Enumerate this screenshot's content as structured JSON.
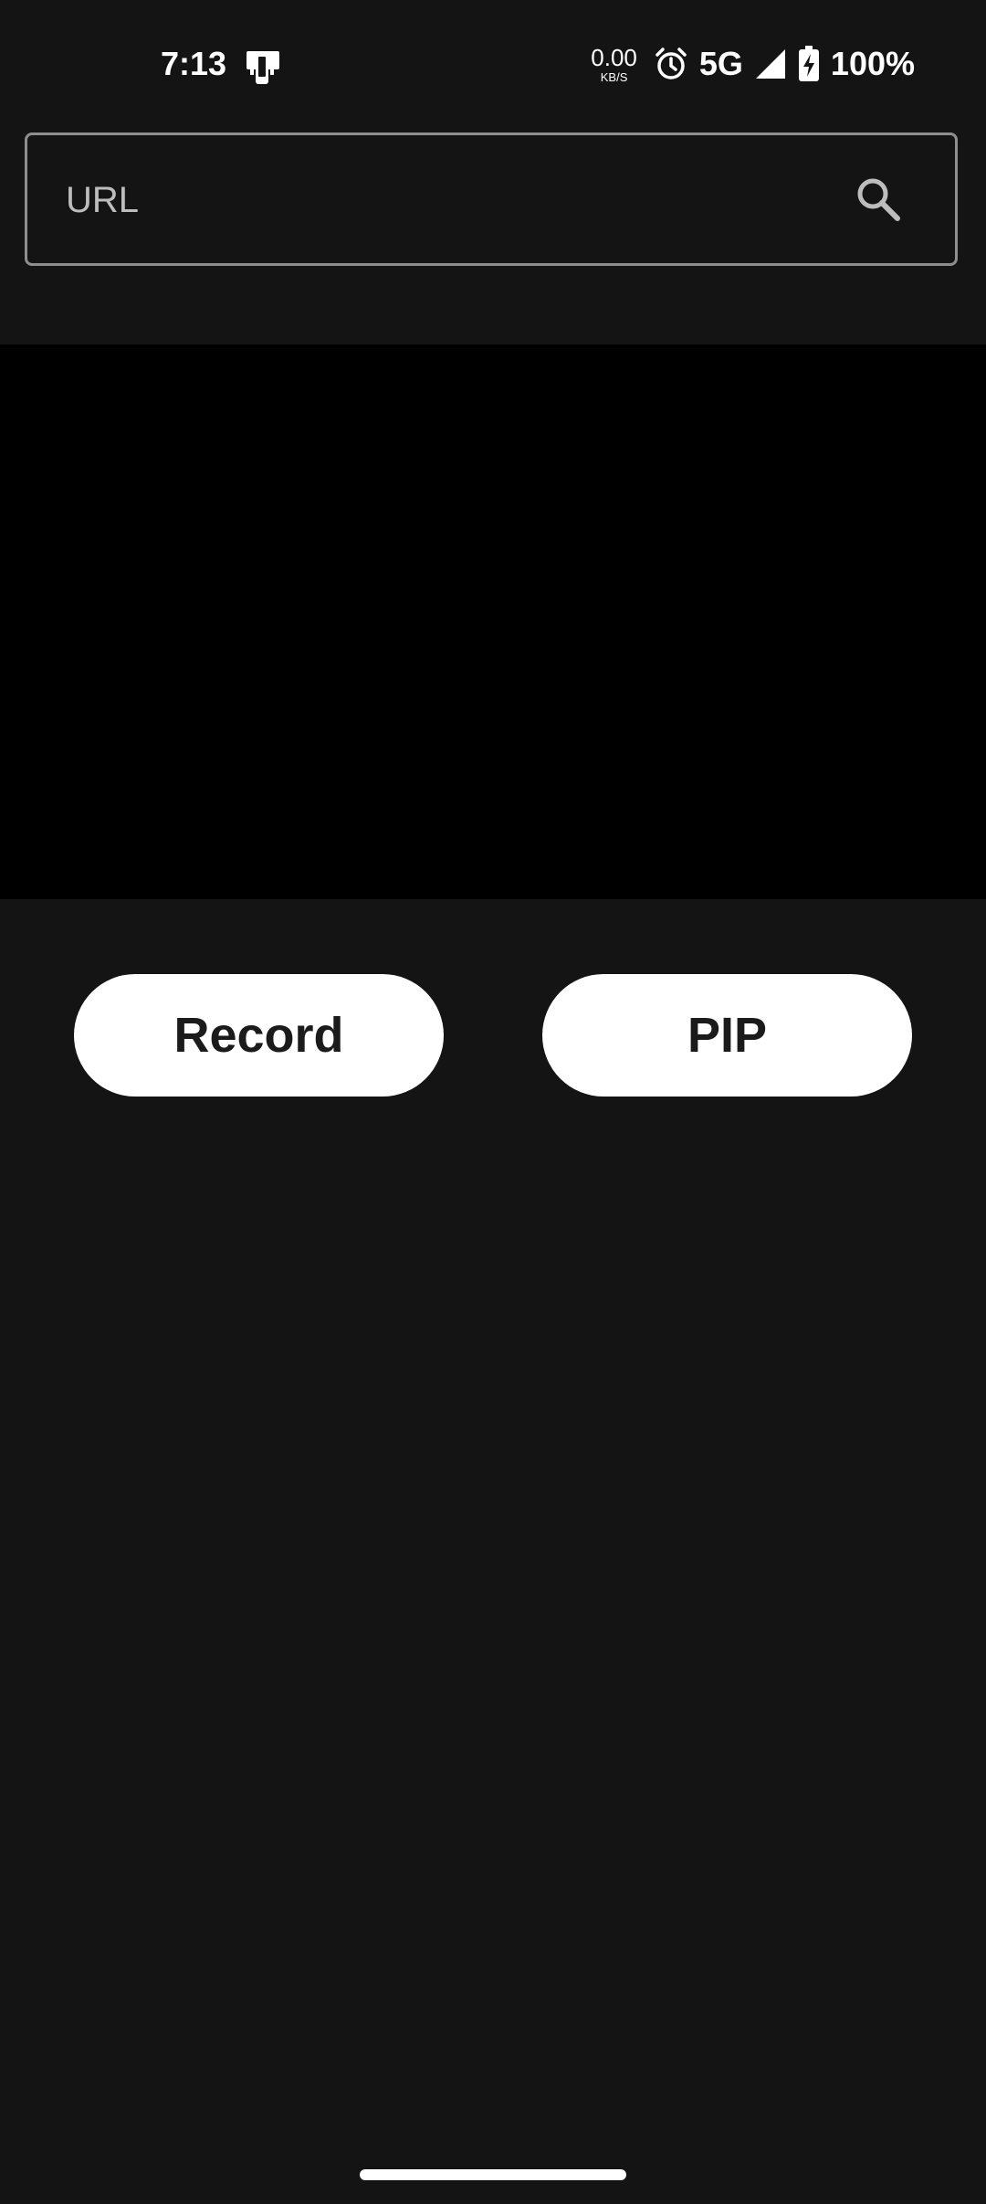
{
  "status_bar": {
    "time": "7:13",
    "app_icon": "phone-app-icon",
    "net_speed_value": "0.00",
    "net_speed_unit": "KB/S",
    "alarm_icon": "alarm-icon",
    "network_type": "5G",
    "signal_icon": "signal-icon",
    "battery_icon": "battery-charging-icon",
    "battery_percent": "100%"
  },
  "url_field": {
    "value": "",
    "placeholder": "URL",
    "search_icon": "search-icon"
  },
  "buttons": {
    "record_label": "Record",
    "pip_label": "PIP"
  },
  "colors": {
    "background": "#141414",
    "video_background": "#000000",
    "button_background": "#ffffff",
    "button_text": "#1b1b1b",
    "field_border": "#8e8e8e",
    "placeholder": "#bdbdbd"
  }
}
